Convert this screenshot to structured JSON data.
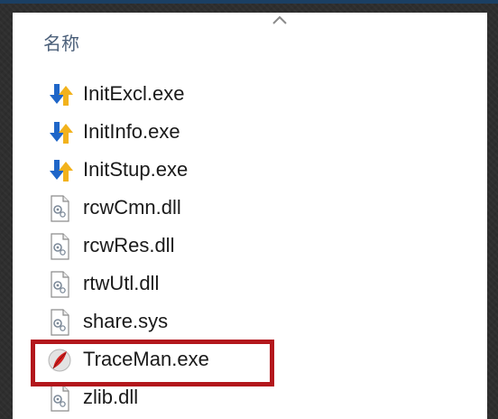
{
  "window": {
    "accent_color": "#1b3f63",
    "sort_indicator": "chevron-up-icon"
  },
  "list_header": {
    "name_column_label": "名称"
  },
  "files": [
    {
      "name": "InitExcl.exe",
      "icon": "installer-arrows-icon"
    },
    {
      "name": "InitInfo.exe",
      "icon": "installer-arrows-icon"
    },
    {
      "name": "InitStup.exe",
      "icon": "installer-arrows-icon"
    },
    {
      "name": "rcwCmn.dll",
      "icon": "dll-file-icon"
    },
    {
      "name": "rcwRes.dll",
      "icon": "dll-file-icon"
    },
    {
      "name": "rtwUtl.dll",
      "icon": "dll-file-icon"
    },
    {
      "name": "share.sys",
      "icon": "sys-file-icon"
    },
    {
      "name": "TraceMan.exe",
      "icon": "traceman-app-icon"
    },
    {
      "name": "zlib.dll",
      "icon": "dll-file-icon"
    }
  ],
  "annotation": {
    "highlight_color": "#b3171c",
    "highlighted_file": "TraceMan.exe"
  }
}
